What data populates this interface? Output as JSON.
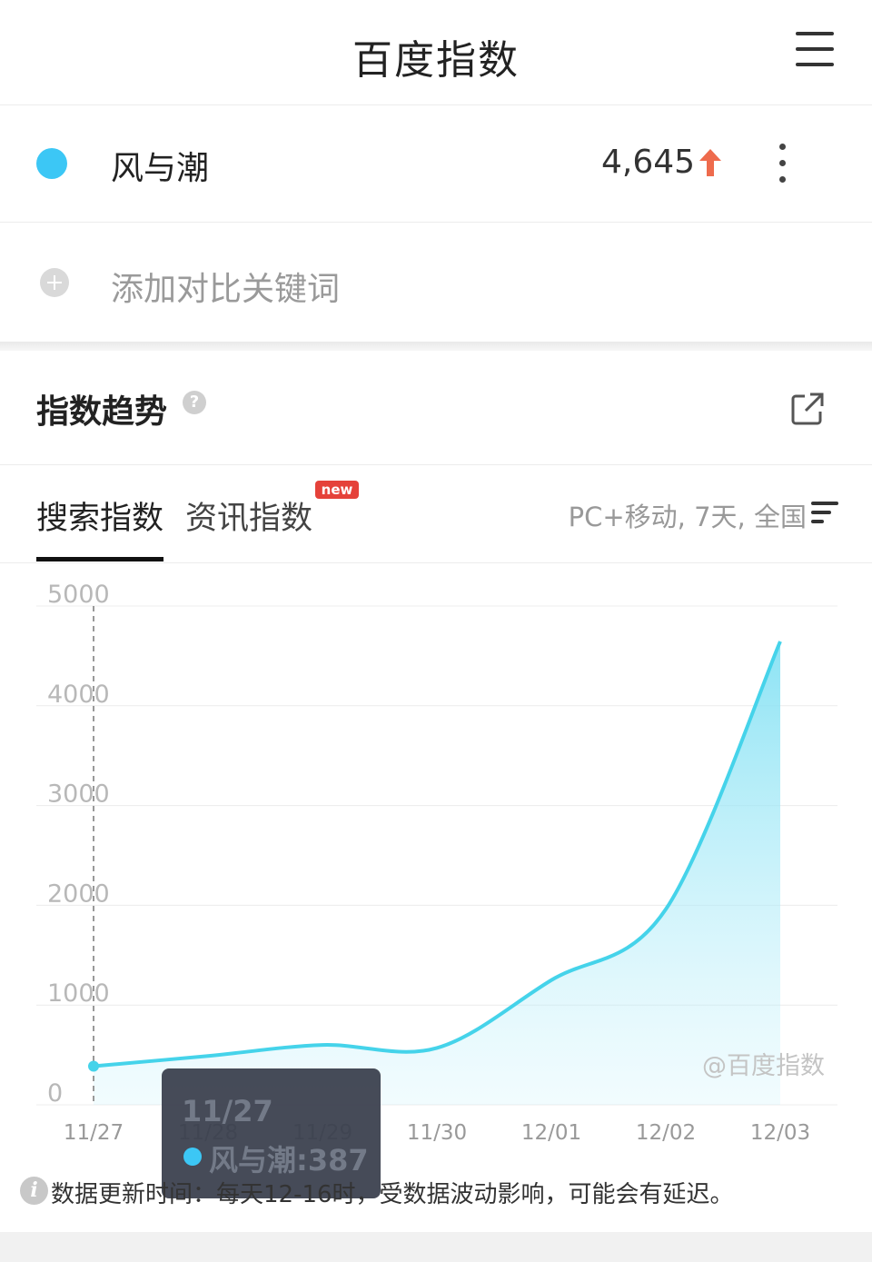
{
  "header": {
    "title": "百度指数"
  },
  "keyword": {
    "name": "风与潮",
    "value": "4,645",
    "trend": "up",
    "dot_color": "#3cc7f5",
    "trend_color": "#ee6b4d"
  },
  "add_keyword": {
    "label": "添加对比关键词"
  },
  "section": {
    "title": "指数趋势"
  },
  "tabs": [
    {
      "label": "搜索指数",
      "active": true
    },
    {
      "label": "资讯指数",
      "active": false,
      "badge": "new"
    }
  ],
  "filter": {
    "label": "PC+移动, 7天, 全国"
  },
  "chart_data": {
    "type": "area",
    "x": [
      "11/27",
      "11/28",
      "11/29",
      "11/30",
      "12/01",
      "12/02",
      "12/03"
    ],
    "y_ticks": [
      "5000",
      "4000",
      "3000",
      "2000",
      "1000",
      "0"
    ],
    "ylim": [
      0,
      5000
    ],
    "series": [
      {
        "name": "风与潮",
        "values": [
          387,
          490,
          600,
          570,
          1250,
          1960,
          4645
        ],
        "color": "#45d3ea"
      }
    ],
    "watermark": "@百度指数",
    "grid": true
  },
  "tooltip": {
    "date": "11/27",
    "series": "风与潮",
    "value": "387"
  },
  "footer_note": "数据更新时间：每天12-16时，受数据波动影响，可能会有延迟。"
}
